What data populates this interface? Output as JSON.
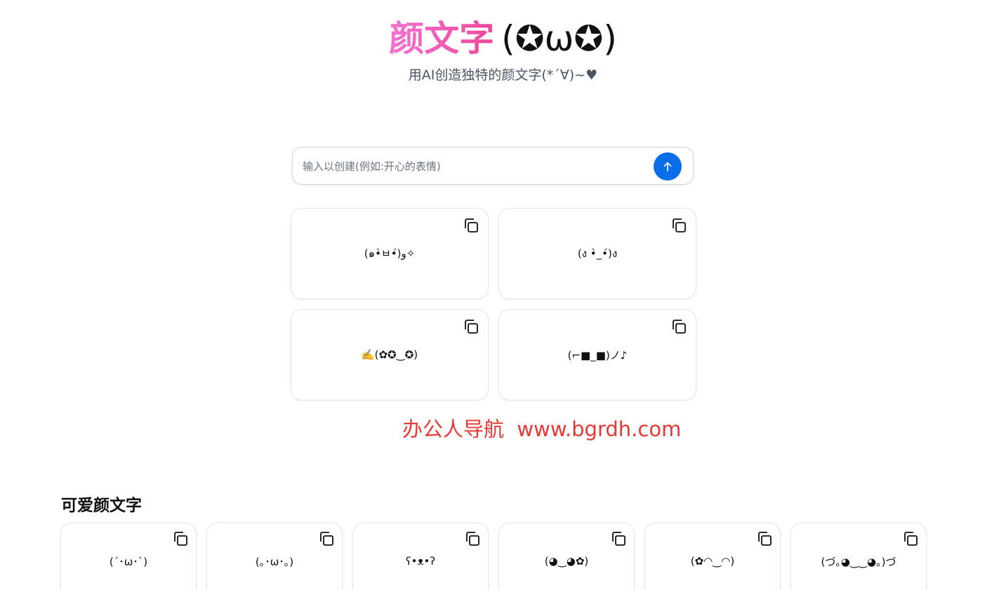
{
  "header": {
    "title": "颜文字",
    "title_face": "(✪ω✪)",
    "subtitle": "用AI创造独特的颜文字(*´∀)~♥"
  },
  "search": {
    "placeholder": "输入以创建(例如:开心的表情)",
    "value": "",
    "submit_icon": "arrow-up-icon",
    "accent_color": "#0a6ee8"
  },
  "results": [
    {
      "text": "(๑•̀ㅂ•́)و✧",
      "icon": "copy-icon"
    },
    {
      "text": "(ง •̀_•́)ง",
      "icon": "copy-icon"
    },
    {
      "text": "✍️(✿✪‿✪)",
      "icon": "copy-icon"
    },
    {
      "text": "(⌐■_■)ノ♪",
      "icon": "copy-icon"
    }
  ],
  "watermark": "办公人导航  www.bgrdh.com",
  "cute_section": {
    "title": "可爱颜文字",
    "items": [
      {
        "text": "(´･ω･`)"
      },
      {
        "text": "(｡･ω･｡)"
      },
      {
        "text": "ʕ•ᴥ•ʔ"
      },
      {
        "text": "(◕‿◕✿)"
      },
      {
        "text": "(✿◠‿◠)"
      },
      {
        "text": "(づ｡◕‿‿◕｡)づ"
      }
    ]
  },
  "colors": {
    "title_gradient_start": "#f472d0",
    "title_gradient_end": "#ec4899",
    "watermark": "#e53935"
  }
}
